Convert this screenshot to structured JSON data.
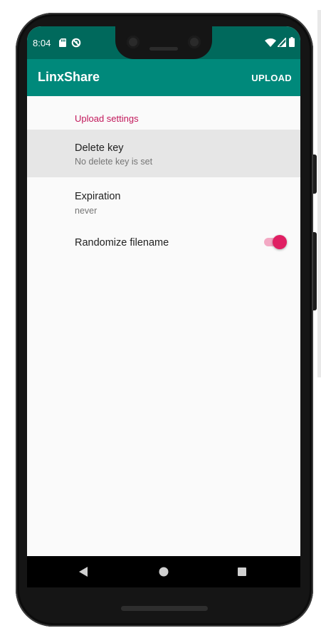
{
  "status_bar": {
    "time": "8:04",
    "icons_left": [
      "sd-card-icon",
      "sync-off-icon"
    ],
    "icons_right": [
      "wifi-icon",
      "cellular-signal-icon",
      "battery-icon"
    ]
  },
  "app_bar": {
    "title": "LinxShare",
    "action_label": "UPLOAD"
  },
  "settings": {
    "category_title": "Upload settings",
    "items": [
      {
        "title": "Delete key",
        "summary": "No delete key is set"
      },
      {
        "title": "Expiration",
        "summary": "never"
      },
      {
        "title": "Randomize filename",
        "switch_on": true
      }
    ]
  },
  "nav_bar": {
    "buttons": [
      "back-icon",
      "home-icon",
      "recents-icon"
    ]
  },
  "colors": {
    "status_bar": "#00695c",
    "app_bar": "#00897b",
    "accent": "#e01f63",
    "category_text": "#c2185b"
  }
}
